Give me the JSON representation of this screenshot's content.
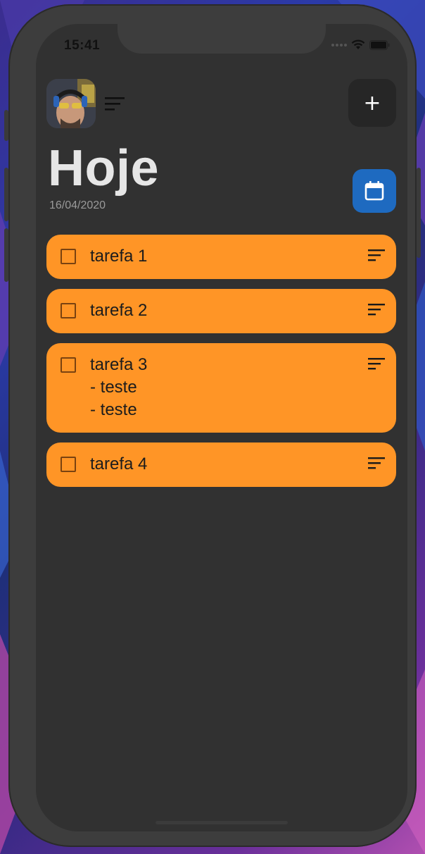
{
  "status_bar": {
    "time": "15:41",
    "wifi_icon": "wifi-icon",
    "battery_icon": "battery-icon"
  },
  "header": {
    "avatar_icon": "avatar",
    "menu_icon": "sort-lines-icon",
    "add_button_label": "+",
    "title": "Hoje",
    "date": "16/04/2020",
    "calendar_icon": "calendar-icon"
  },
  "colors": {
    "background": "#313131",
    "task_card": "#ff9526",
    "calendar_button": "#1e6ac0",
    "add_button": "#262626",
    "title_text": "#e6e6e6"
  },
  "tasks": [
    {
      "title": "tarefa 1",
      "notes": []
    },
    {
      "title": "tarefa 2",
      "notes": []
    },
    {
      "title": "tarefa 3",
      "notes": [
        "- teste",
        "- teste"
      ]
    },
    {
      "title": "tarefa 4",
      "notes": []
    }
  ]
}
